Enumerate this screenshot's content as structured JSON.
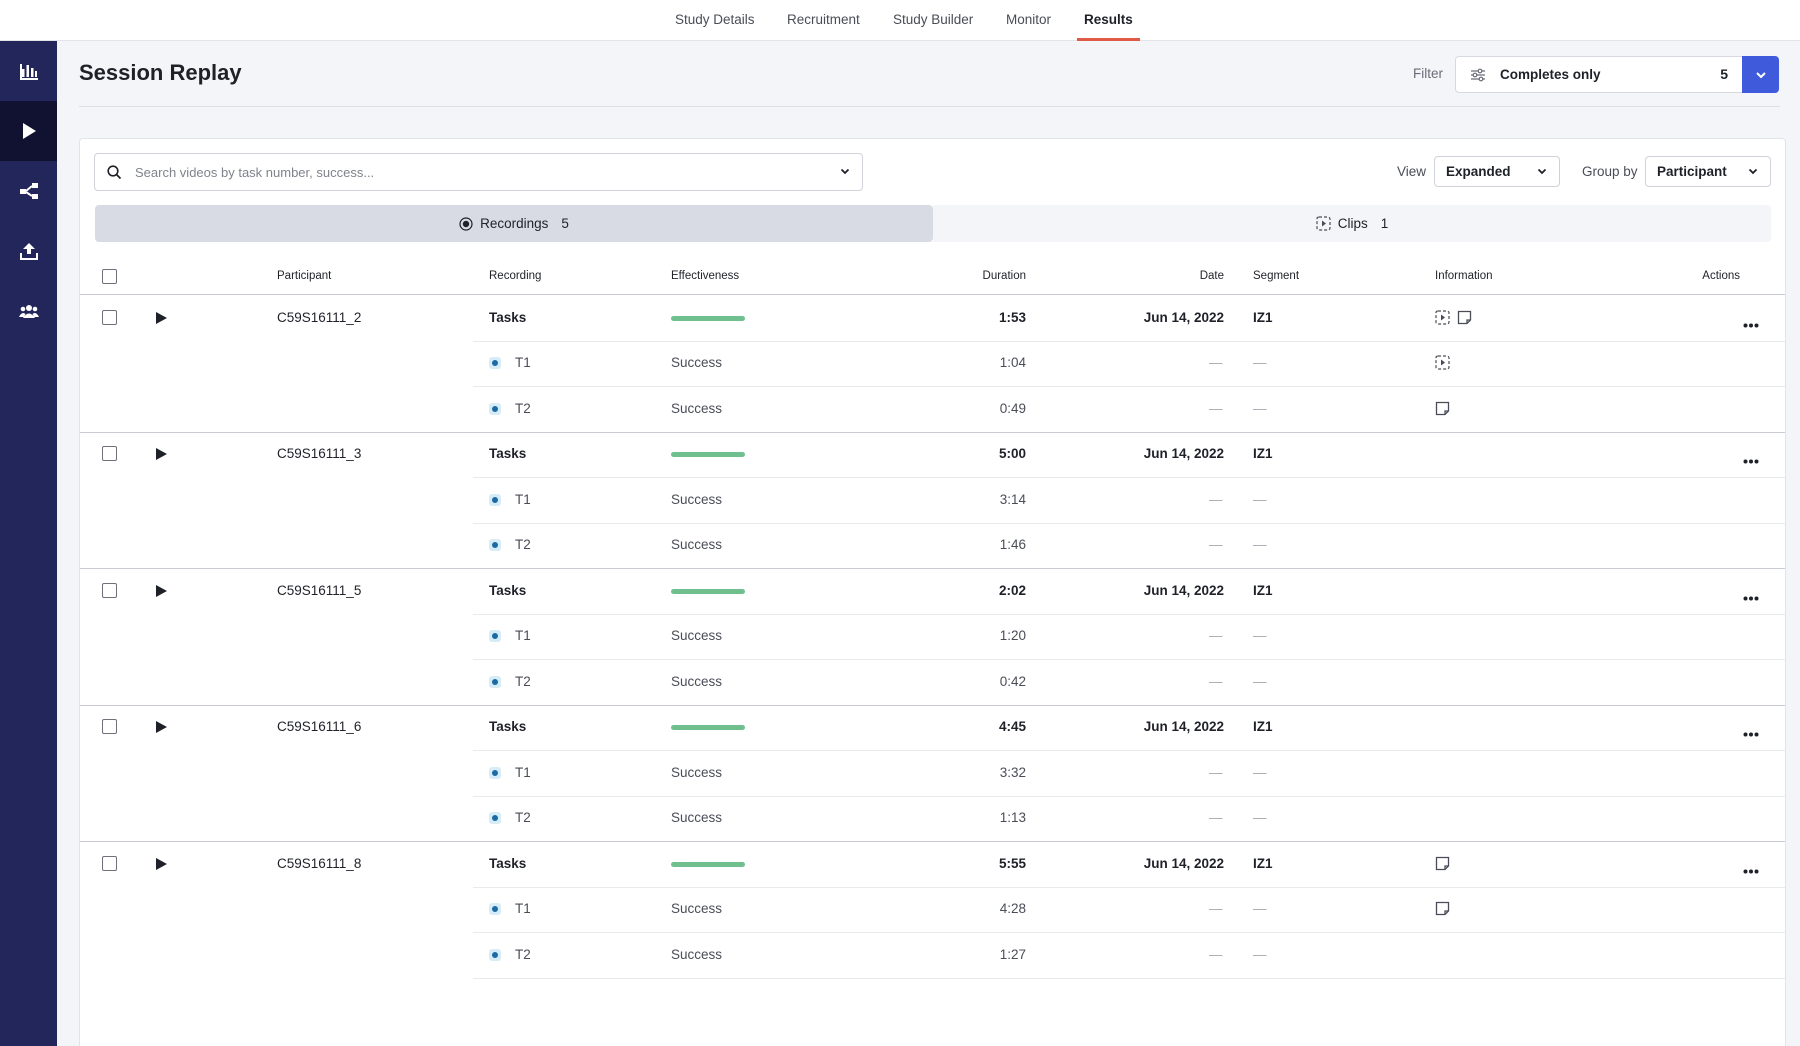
{
  "topnav": {
    "tabs": [
      {
        "label": "Study Details",
        "active": false
      },
      {
        "label": "Recruitment",
        "active": false
      },
      {
        "label": "Study Builder",
        "active": false
      },
      {
        "label": "Monitor",
        "active": false
      },
      {
        "label": "Results",
        "active": true
      }
    ]
  },
  "sidebar": {
    "items": [
      {
        "icon": "bar-chart-icon",
        "active": false
      },
      {
        "icon": "play-icon",
        "active": true
      },
      {
        "icon": "share-flow-icon",
        "active": false
      },
      {
        "icon": "upload-icon",
        "active": false
      },
      {
        "icon": "people-icon",
        "active": false
      }
    ]
  },
  "header": {
    "title": "Session Replay",
    "filter_label": "Filter",
    "filter_value": "Completes only",
    "filter_count": "5"
  },
  "toolbar": {
    "search_placeholder": "Search videos by task number, success...",
    "view_label": "View",
    "view_value": "Expanded",
    "group_label": "Group by",
    "group_value": "Participant"
  },
  "segments": {
    "recordings_label": "Recordings",
    "recordings_count": "5",
    "clips_label": "Clips",
    "clips_count": "1"
  },
  "table": {
    "columns": {
      "participant": "Participant",
      "recording": "Recording",
      "effectiveness": "Effectiveness",
      "duration": "Duration",
      "date": "Date",
      "segment": "Segment",
      "information": "Information",
      "actions": "Actions"
    },
    "dash": "—",
    "groups": [
      {
        "participant": "C59S16111_2",
        "recording": "Tasks",
        "effectiveness": 1.0,
        "duration": "1:53",
        "date": "Jun 14, 2022",
        "segment": "IZ1",
        "info": [
          "clip-icon",
          "note-icon"
        ],
        "tasks": [
          {
            "task": "T1",
            "result": "Success",
            "duration": "1:04",
            "info": [
              "clip-icon"
            ]
          },
          {
            "task": "T2",
            "result": "Success",
            "duration": "0:49",
            "info": [
              "note-icon"
            ]
          }
        ]
      },
      {
        "participant": "C59S16111_3",
        "recording": "Tasks",
        "effectiveness": 1.0,
        "duration": "5:00",
        "date": "Jun 14, 2022",
        "segment": "IZ1",
        "info": [],
        "tasks": [
          {
            "task": "T1",
            "result": "Success",
            "duration": "3:14",
            "info": []
          },
          {
            "task": "T2",
            "result": "Success",
            "duration": "1:46",
            "info": []
          }
        ]
      },
      {
        "participant": "C59S16111_5",
        "recording": "Tasks",
        "effectiveness": 1.0,
        "duration": "2:02",
        "date": "Jun 14, 2022",
        "segment": "IZ1",
        "info": [],
        "tasks": [
          {
            "task": "T1",
            "result": "Success",
            "duration": "1:20",
            "info": []
          },
          {
            "task": "T2",
            "result": "Success",
            "duration": "0:42",
            "info": []
          }
        ]
      },
      {
        "participant": "C59S16111_6",
        "recording": "Tasks",
        "effectiveness": 1.0,
        "duration": "4:45",
        "date": "Jun 14, 2022",
        "segment": "IZ1",
        "info": [],
        "tasks": [
          {
            "task": "T1",
            "result": "Success",
            "duration": "3:32",
            "info": []
          },
          {
            "task": "T2",
            "result": "Success",
            "duration": "1:13",
            "info": []
          }
        ]
      },
      {
        "participant": "C59S16111_8",
        "recording": "Tasks",
        "effectiveness": 1.0,
        "duration": "5:55",
        "date": "Jun 14, 2022",
        "segment": "IZ1",
        "info": [
          "note-icon"
        ],
        "tasks": [
          {
            "task": "T1",
            "result": "Success",
            "duration": "4:28",
            "info": [
              "note-icon"
            ]
          },
          {
            "task": "T2",
            "result": "Success",
            "duration": "1:27",
            "info": []
          }
        ]
      }
    ]
  },
  "colors": {
    "sidebar_bg": "#23265a",
    "accent": "#3f5bdc",
    "active_tab_underline": "#e05a47",
    "effectiveness_bar": "#6fbf8f"
  }
}
